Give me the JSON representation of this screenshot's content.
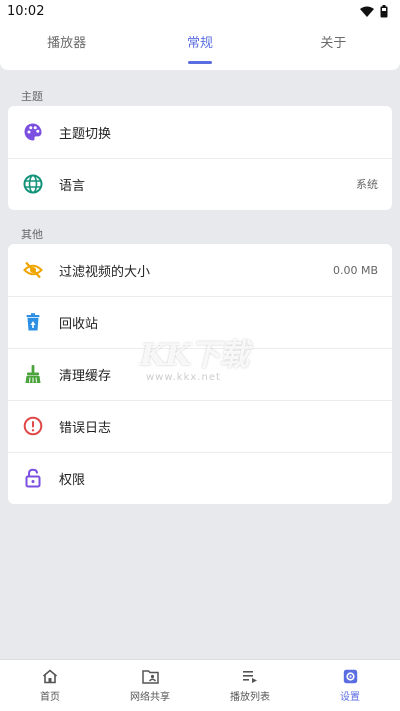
{
  "status_bar": {
    "time": "10:02"
  },
  "top_tabs": [
    {
      "label": "播放器",
      "active": false
    },
    {
      "label": "常规",
      "active": true
    },
    {
      "label": "关于",
      "active": false
    }
  ],
  "sections": {
    "theme": {
      "title": "主题",
      "items": [
        {
          "label": "主题切换",
          "value": "",
          "icon": "palette-icon"
        },
        {
          "label": "语言",
          "value": "系统",
          "icon": "globe-icon"
        }
      ]
    },
    "other": {
      "title": "其他",
      "items": [
        {
          "label": "过滤视频的大小",
          "value": "0.00 MB",
          "icon": "eye-off-icon"
        },
        {
          "label": "回收站",
          "value": "",
          "icon": "recycle-bin-icon"
        },
        {
          "label": "清理缓存",
          "value": "",
          "icon": "broom-icon"
        },
        {
          "label": "错误日志",
          "value": "",
          "icon": "error-icon"
        },
        {
          "label": "权限",
          "value": "",
          "icon": "lock-icon"
        }
      ]
    }
  },
  "watermark": {
    "big": "KK下载",
    "small": "www.kkx.net"
  },
  "bottom_nav": [
    {
      "label": "首页",
      "icon": "home-icon",
      "active": false
    },
    {
      "label": "网络共享",
      "icon": "network-share-icon",
      "active": false
    },
    {
      "label": "播放列表",
      "icon": "playlist-icon",
      "active": false
    },
    {
      "label": "设置",
      "icon": "settings-icon",
      "active": true
    }
  ],
  "colors": {
    "accent": "#5b6ee1",
    "background": "#e8e9ed",
    "palette_icon": "#7b4fe0",
    "globe_icon": "#15937a",
    "eye_off_icon": "#f0a400",
    "recycle_icon": "#2c8fe3",
    "broom_icon": "#4aa33b",
    "error_icon": "#e04848",
    "lock_icon": "#7b4fe0"
  }
}
